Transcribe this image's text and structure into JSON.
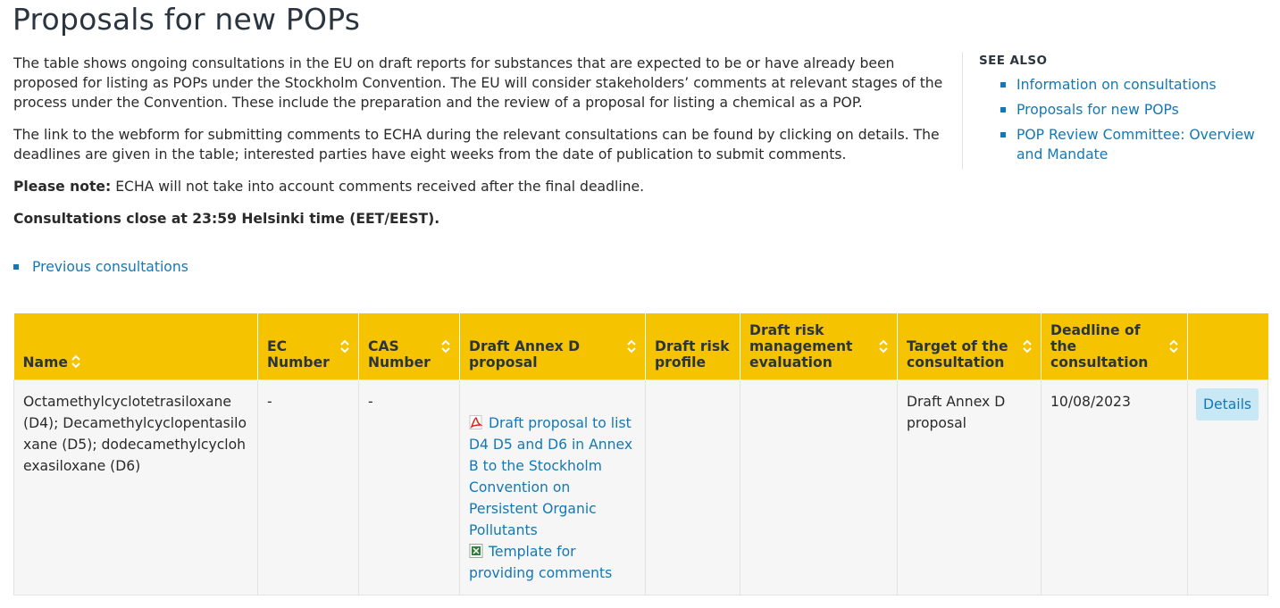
{
  "page": {
    "title": "Proposals for new POPs"
  },
  "intro": {
    "paragraph1": "The table shows ongoing consultations in the EU on draft reports for substances that are expected to be or have already been proposed for listing as POPs under the Stockholm Convention. The EU will consider stakeholders’ comments at relevant stages of the process under the Convention. These include the preparation and the review of a proposal for listing a chemical as a POP.",
    "paragraph2": "The link to the webform for submitting comments to ECHA during the relevant consultations can be found by clicking on details. The deadlines are given in the table; interested parties have eight weeks from the date of publication to submit comments.",
    "note_label": "Please note:",
    "note_text": " ECHA will not take into account comments received after the final deadline.",
    "closing_time": "Consultations close at 23:59 Helsinki time (EET/EEST).",
    "previous_link": "Previous consultations"
  },
  "see_also": {
    "heading": "SEE ALSO",
    "links": [
      "Information on consultations",
      "Proposals for new POPs",
      "POP Review Committee: Overview and Mandate"
    ]
  },
  "table": {
    "headers": [
      "Name",
      "EC Number",
      "CAS Number",
      "Draft Annex D proposal",
      "Draft risk profile",
      "Draft risk management evaluation",
      "Target of the consultation",
      "Deadline of the consultation",
      ""
    ],
    "rows": [
      {
        "name": "Octamethylcyclotetrasiloxane (D4); Decamethylcyclopentasiloxane (D5); dodecamethylcyclohexasiloxane (D6)",
        "ec_number": "-",
        "cas_number": "-",
        "annex_d_docs": [
          {
            "icon": "pdf-icon",
            "label": "Draft proposal to list D4 D5 and D6 in Annex B to the Stockholm Convention on Persistent Organic Pollutants"
          },
          {
            "icon": "excel-icon",
            "label": "Template for providing comments"
          }
        ],
        "risk_profile": "",
        "risk_management": "",
        "target": "Draft Annex D proposal",
        "deadline": "10/08/2023",
        "details_label": "Details"
      }
    ]
  },
  "colors": {
    "header_bg": "#f6c300",
    "link": "#1478b4",
    "button_bg": "#c9e8f5"
  }
}
